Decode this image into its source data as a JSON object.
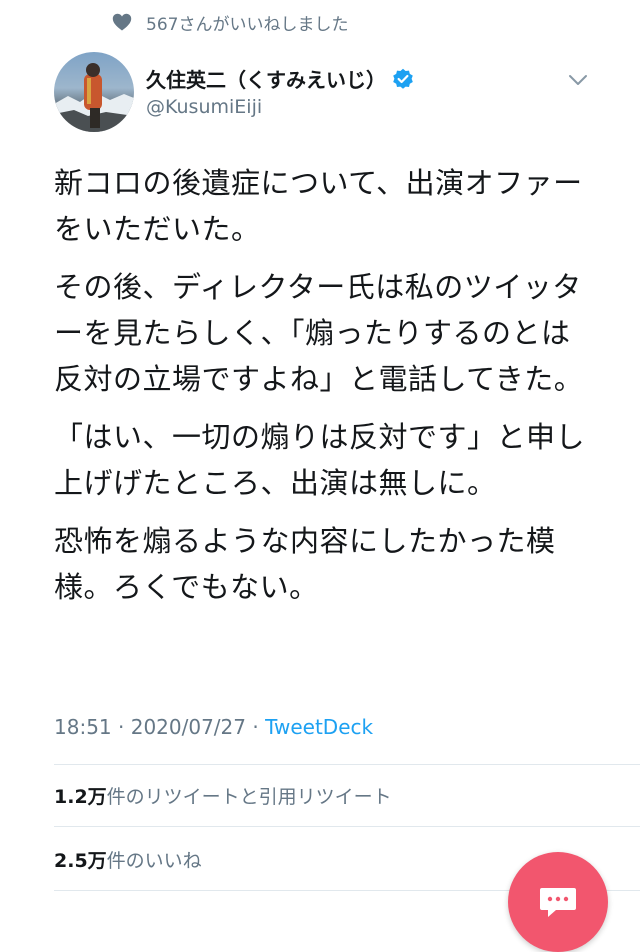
{
  "liked_by": {
    "text": "567さんがいいねしました"
  },
  "author": {
    "display_name": "久住英二（くすみえいじ）",
    "handle": "@KusumiEiji"
  },
  "tweet": {
    "paragraphs": [
      "新コロの後遺症について、出演オファーをいただいた。",
      "その後、ディレクター氏は私のツイッターを見たらしく、「煽ったりするのとは反対の立場ですよね」と電話してきた。",
      "「はい、一切の煽りは反対です」と申し上げげたところ、出演は無しに。",
      "恐怖を煽るような内容にしたかった模様。ろくでもない。"
    ]
  },
  "meta": {
    "time": "18:51",
    "sep1": " · ",
    "date": "2020/07/27",
    "sep2": " · ",
    "source": "TweetDeck"
  },
  "stats": {
    "retweets_count": "1.2万",
    "retweets_label": "件のリツイートと引用リツイート",
    "likes_count": "2.5万",
    "likes_label": "件のいいね"
  },
  "icons": {
    "liked": "heart-icon",
    "verified": "verified-badge-icon",
    "menu": "chevron-down-icon",
    "compose": "speech-bubble-icon"
  },
  "colors": {
    "accent": "#1da1f2",
    "secondary_text": "#657786",
    "fab": "#f2566e"
  }
}
